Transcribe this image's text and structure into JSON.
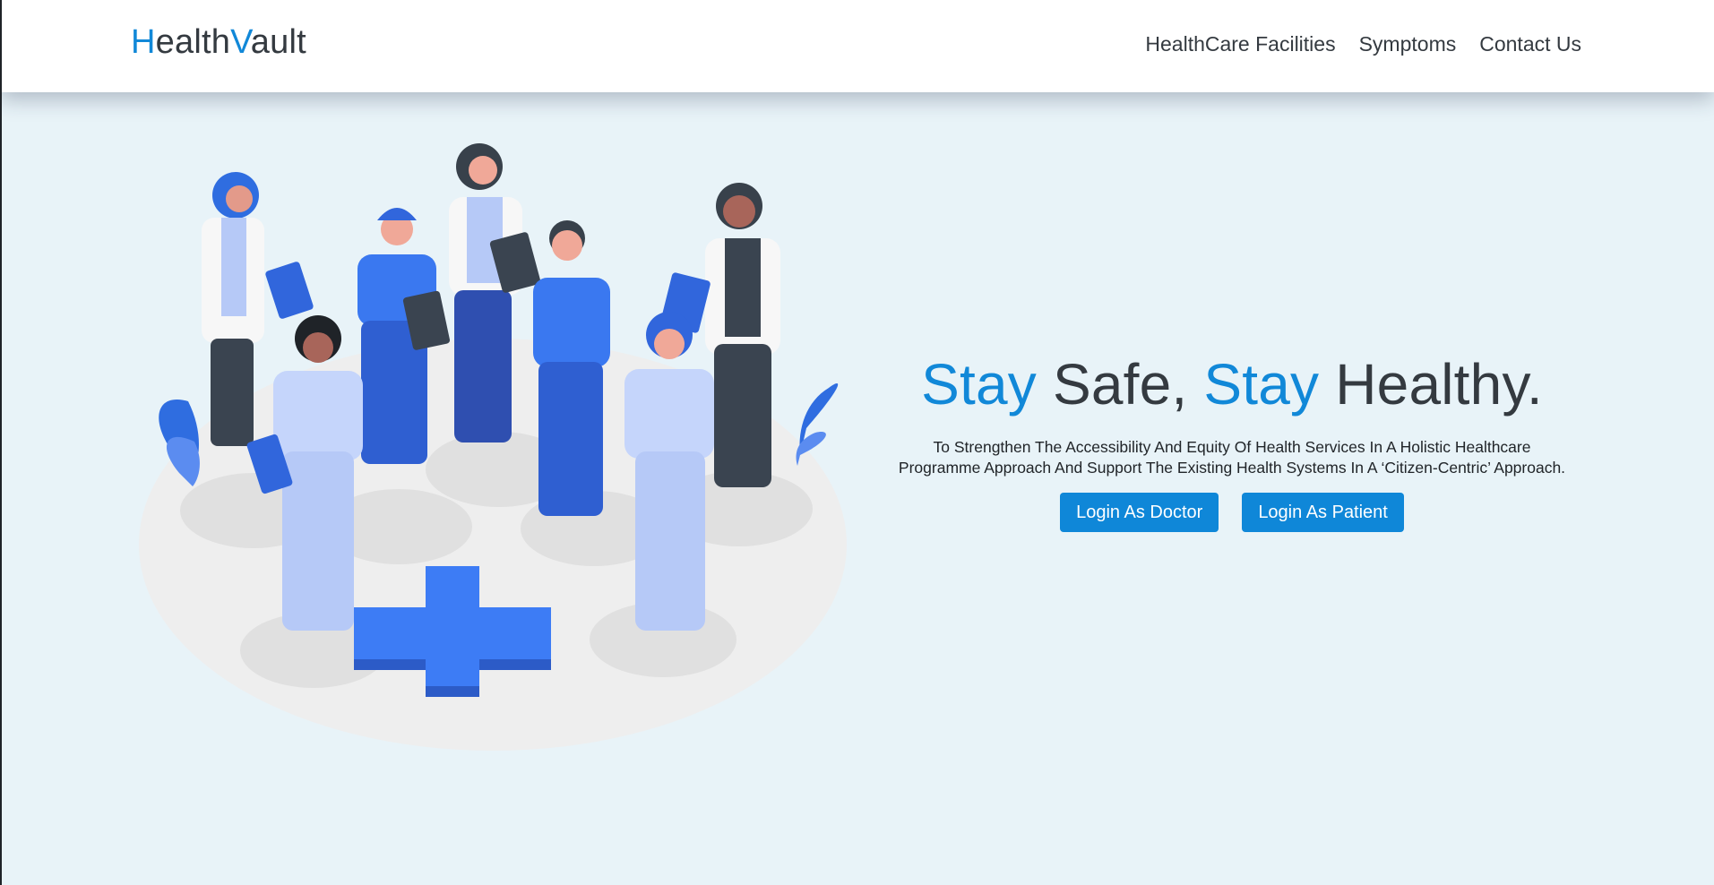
{
  "brand": {
    "first_initial": "H",
    "first_rest": "ealth",
    "second_initial": "V",
    "second_rest": "ault"
  },
  "nav": {
    "items": [
      {
        "label": "HealthCare Facilities"
      },
      {
        "label": "Symptoms"
      },
      {
        "label": "Contact Us"
      }
    ]
  },
  "hero": {
    "headline": {
      "word1": "Stay",
      "word2": " Safe, ",
      "word3": "Stay",
      "word4": " Healthy."
    },
    "tagline_line1": "To Strengthen The Accessibility And Equity Of Health Services In A Holistic Healthcare",
    "tagline_line2": "Programme Approach And Support The Existing Health Systems In A ‘Citizen-Centric’ Approach.",
    "buttons": {
      "doctor": "Login As Doctor",
      "patient": "Login As Patient"
    }
  },
  "colors": {
    "accent": "#1188d8",
    "button": "#0f87d8",
    "page_background": "#e8f3f8",
    "text_dark": "#343a40"
  }
}
